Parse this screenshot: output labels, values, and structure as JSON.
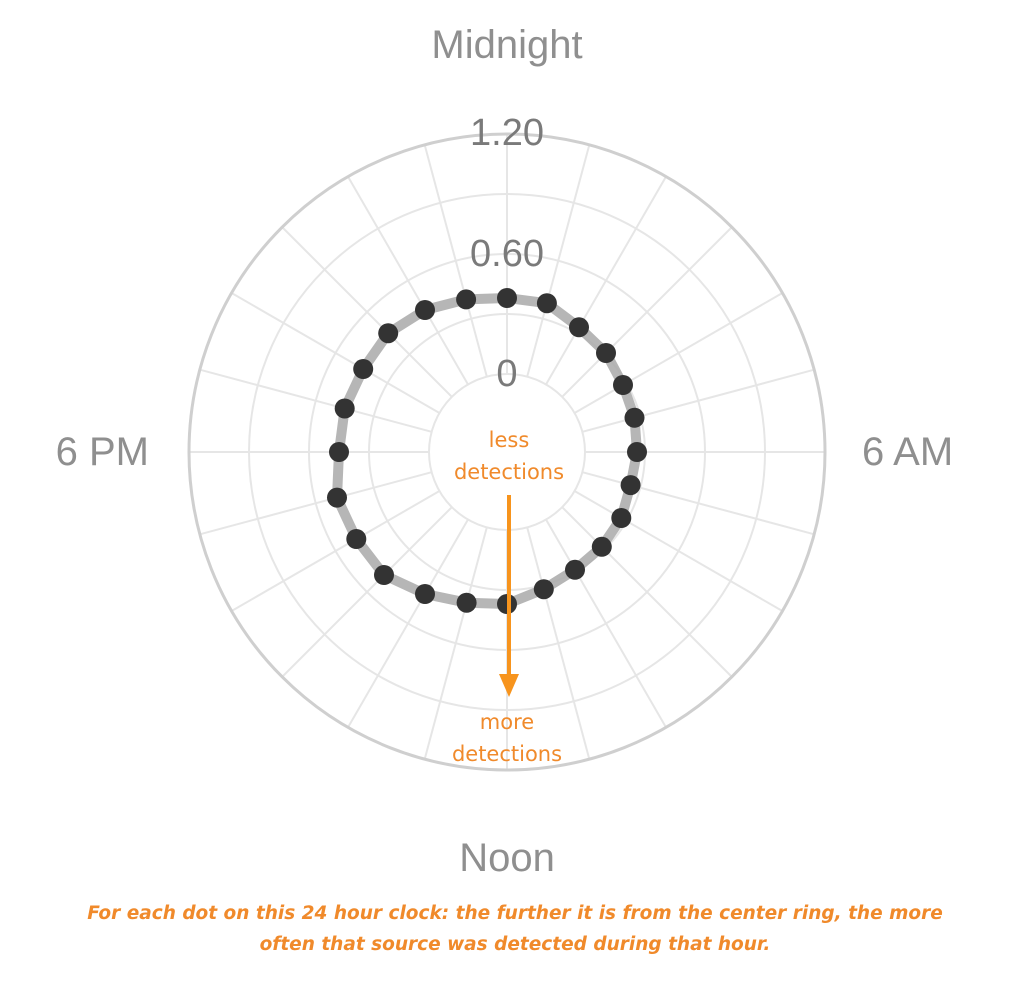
{
  "chart_data": {
    "type": "radial-scatter",
    "angular_labels": {
      "top": "Midnight",
      "right": "6 AM",
      "bottom": "Noon",
      "left": "6 PM"
    },
    "radial_ticks": [
      "0",
      "0.60",
      "1.20"
    ],
    "radial_range": [
      0,
      1.2
    ],
    "hours": [
      0,
      1,
      2,
      3,
      4,
      5,
      6,
      7,
      8,
      9,
      10,
      11,
      12,
      13,
      14,
      15,
      16,
      17,
      18,
      19,
      20,
      21,
      22,
      23
    ],
    "values": [
      0.38,
      0.38,
      0.33,
      0.31,
      0.28,
      0.27,
      0.26,
      0.25,
      0.27,
      0.28,
      0.29,
      0.32,
      0.37,
      0.39,
      0.43,
      0.48,
      0.48,
      0.49,
      0.45,
      0.45,
      0.44,
      0.45,
      0.43,
      0.4
    ],
    "grid": true,
    "annotations": {
      "inner": [
        "less",
        "detections"
      ],
      "outer": [
        "more",
        "detections"
      ]
    },
    "colors": {
      "dot": "#333333",
      "path": "#a9a9a9",
      "annotation": "#f08a2b",
      "grid": "#e6e6e6",
      "ring": "#cfcfcf",
      "label": "#8f8f8f"
    }
  },
  "caption": {
    "line1": "For each dot on this 24 hour clock: the further it is from the center ring, the more",
    "line2": "often that source was detected during that hour."
  }
}
